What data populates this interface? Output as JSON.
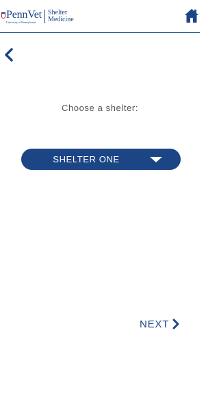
{
  "header": {
    "logo_name": "PennVet",
    "logo_university": "University of Pennsylvania",
    "logo_subtitle_line1": "Shelter",
    "logo_subtitle_line2": "Medicine",
    "home_icon": "home-icon"
  },
  "nav": {
    "back_icon": "chevron-left-icon"
  },
  "main": {
    "prompt": "Choose a shelter:",
    "shelter_select": {
      "selected": "SHELTER ONE",
      "caret_icon": "caret-down-icon"
    },
    "next_label": "NEXT",
    "next_icon": "chevron-right-icon"
  },
  "colors": {
    "brand_blue": "#1b4585",
    "prompt_text": "#555555",
    "background": "#ffffff"
  }
}
